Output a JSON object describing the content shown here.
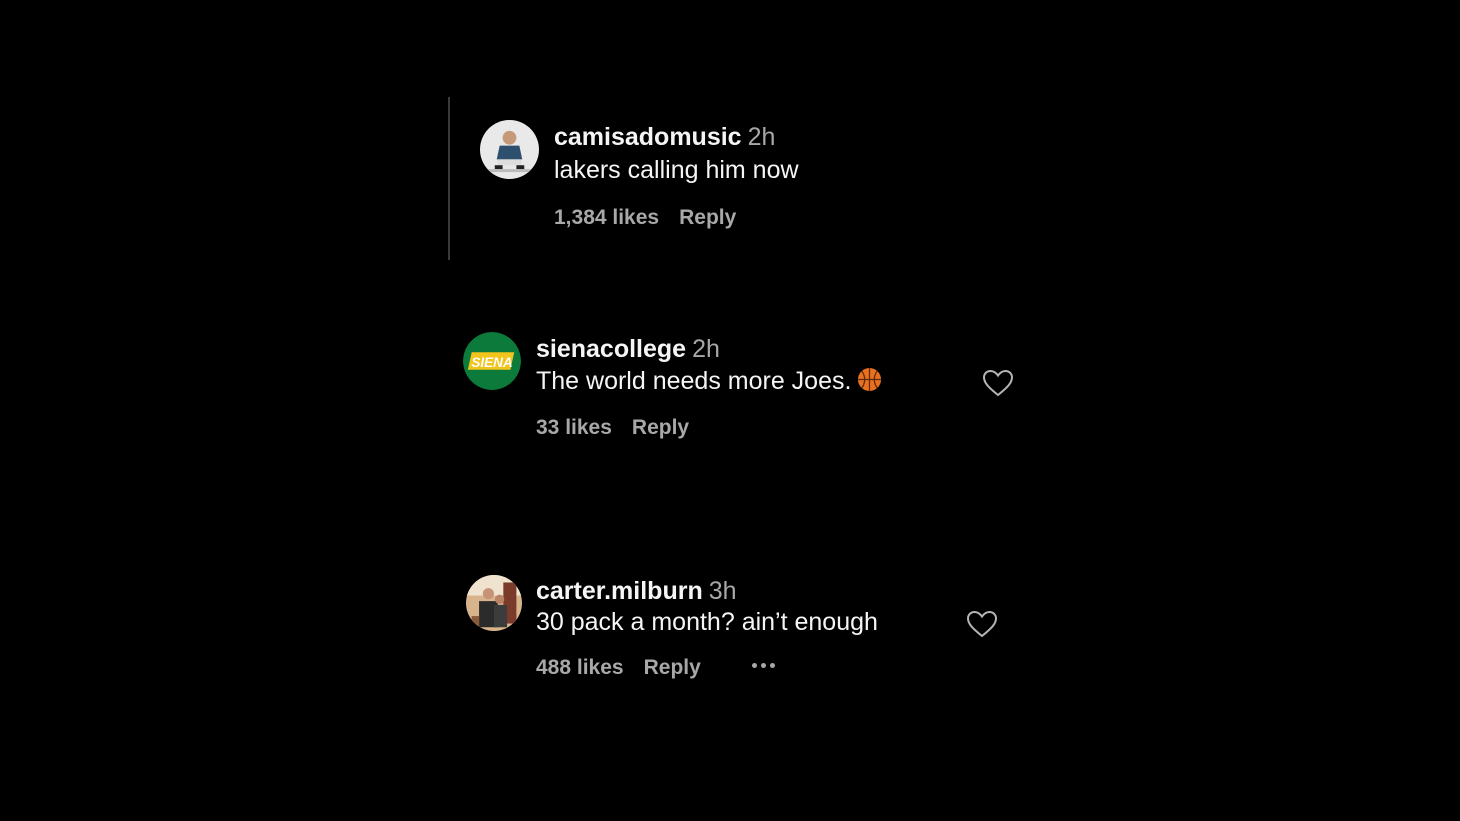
{
  "comments": [
    {
      "username": "camisadomusic",
      "time": "2h",
      "text": "lakers calling him now",
      "likes": "1,384 likes",
      "reply": "Reply"
    },
    {
      "username": "sienacollege",
      "time": "2h",
      "text": "The world needs more Joes.",
      "emoji": "basketball-emoji",
      "likes": "33 likes",
      "reply": "Reply",
      "avatar_text": "SIENA"
    },
    {
      "username": "carter.milburn",
      "time": "3h",
      "text": "30 pack a month? ain’t enough",
      "likes": "488 likes",
      "reply": "Reply"
    }
  ],
  "icons": {
    "like": "heart-outline-icon",
    "more": "more-options-icon"
  },
  "colors": {
    "background": "#000000",
    "text_primary": "#f5f5f5",
    "text_secondary": "#a8a8a8",
    "siena_green": "#0c7a3a",
    "siena_gold": "#f2c51c"
  }
}
